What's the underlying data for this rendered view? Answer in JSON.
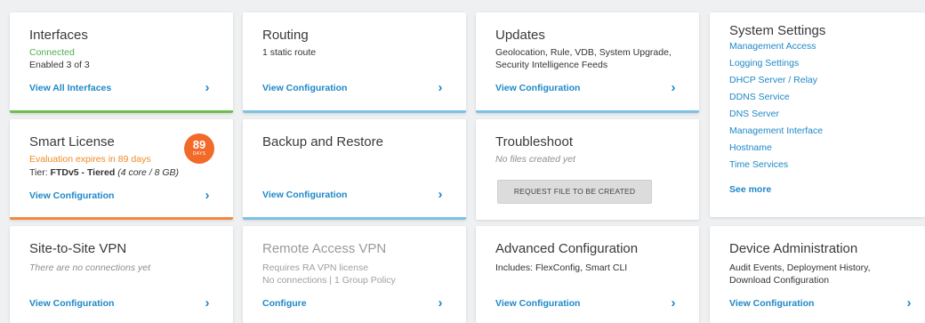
{
  "interfaces": {
    "title": "Interfaces",
    "status": "Connected",
    "enabled": "Enabled 3 of 3",
    "link": "View All Interfaces"
  },
  "routing": {
    "title": "Routing",
    "summary": "1 static route",
    "link": "View Configuration"
  },
  "updates": {
    "title": "Updates",
    "line1": "Geolocation, Rule, VDB, System Upgrade,",
    "line2": "Security Intelligence Feeds",
    "link": "View Configuration"
  },
  "system_settings": {
    "title": "System Settings",
    "items": [
      "Management Access",
      "Logging Settings",
      "DHCP Server / Relay",
      "DDNS Service",
      "DNS Server",
      "Management Interface",
      "Hostname",
      "Time Services"
    ],
    "see_more": "See more"
  },
  "smart_license": {
    "title": "Smart License",
    "evaluation": "Evaluation expires in 89 days",
    "tier_label": "Tier: ",
    "tier_value": "FTDv5 - Tiered",
    "tier_detail": " (4 core / 8 GB)",
    "badge_number": "89",
    "badge_unit": "DAYS",
    "link": "View Configuration"
  },
  "backup_restore": {
    "title": "Backup and Restore",
    "link": "View Configuration"
  },
  "troubleshoot": {
    "title": "Troubleshoot",
    "status": "No files created yet",
    "button": "REQUEST FILE TO BE CREATED"
  },
  "site_to_site_vpn": {
    "title": "Site-to-Site VPN",
    "status": "There are no connections yet",
    "link": "View Configuration"
  },
  "remote_access_vpn": {
    "title": "Remote Access VPN",
    "line1": "Requires RA VPN license",
    "line2": "No connections | 1 Group Policy",
    "link": "Configure"
  },
  "advanced_configuration": {
    "title": "Advanced Configuration",
    "summary": "Includes: FlexConfig, Smart CLI",
    "link": "View Configuration"
  },
  "device_administration": {
    "title": "Device Administration",
    "line1": "Audit Events, Deployment History,",
    "line2": "Download Configuration",
    "link": "View Configuration"
  },
  "colors": {
    "link_blue": "#1e88c8",
    "status_green": "#4caf50",
    "warning_orange": "#f08a24",
    "badge_orange": "#f26a2a"
  }
}
